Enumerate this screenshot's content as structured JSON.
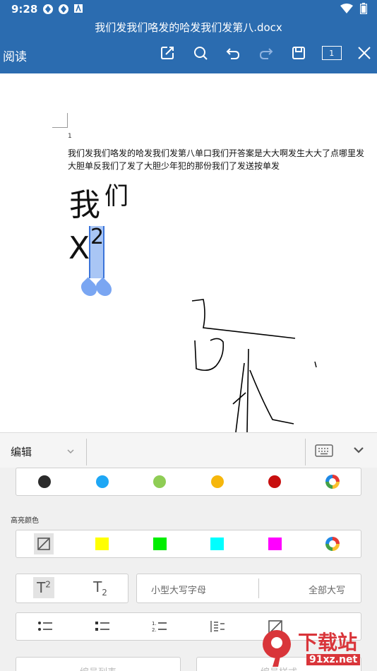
{
  "status": {
    "time": "9:28"
  },
  "header": {
    "title": "我们发我们咯发的哈发我们发第八.docx",
    "mode": "阅读",
    "page_indicator": "1"
  },
  "document": {
    "page_number": "1",
    "lines": [
      "我们发我们咯发的哈发我们发第八单口我们开答案是大大啊发生大大了点哪里发",
      "大胆单反我们了发了大胆少年犯的那份我们了发送按单发"
    ],
    "big_text": "我",
    "big_text_sup": "们",
    "x_text": "X",
    "x_sup": "2"
  },
  "panel": {
    "edit_label": "编辑",
    "highlight_label": "高亮颜色",
    "font_colors": [
      "#2b2b2b",
      "#1ea7f5",
      "#8fcd55",
      "#f6b70c",
      "#c80f0f"
    ],
    "highlight_colors": [
      "#ffff00",
      "#00ee00",
      "#00ffff",
      "#ff00ff"
    ],
    "superscript": "T",
    "superscript_mark": "2",
    "subscript": "T",
    "subscript_mark": "2",
    "small_caps": "小型大写字母",
    "all_caps": "全部大写",
    "bottom_left": "编号列表",
    "bottom_right": "编号样式"
  },
  "watermark": {
    "text": "下载站",
    "sub": "91xz.net"
  }
}
